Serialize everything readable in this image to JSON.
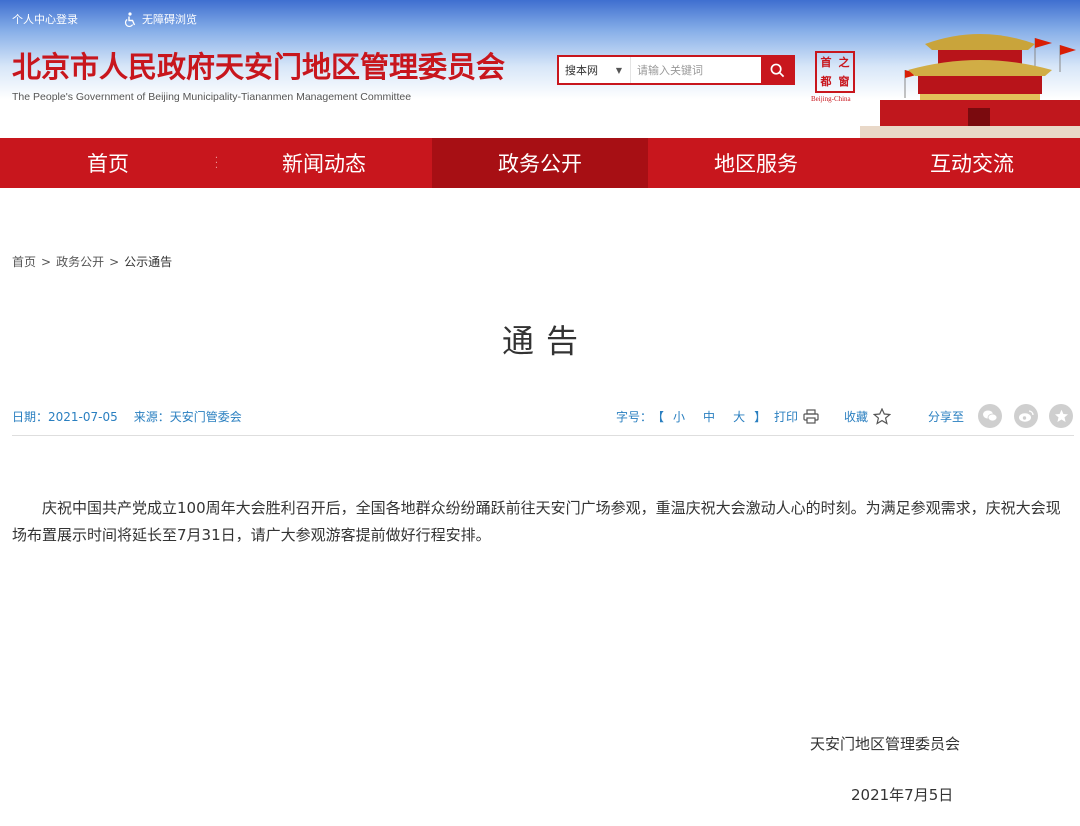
{
  "topbar": {
    "login": "个人中心登录",
    "accessibility": "无障碍浏览"
  },
  "site": {
    "title": "北京市人民政府天安门地区管理委员会",
    "subtitle": "The People's Government of Beijing Municipality-Tiananmen Management Committee"
  },
  "search": {
    "scope": "搜本网",
    "placeholder": "请输入关键词"
  },
  "seal": {
    "chars": [
      "首",
      "之",
      "都",
      "窗"
    ],
    "caption": "Beijing-China"
  },
  "nav": {
    "items": [
      {
        "label": "首页"
      },
      {
        "label": "新闻动态"
      },
      {
        "label": "政务公开"
      },
      {
        "label": "地区服务"
      },
      {
        "label": "互动交流"
      }
    ],
    "active_index": 2
  },
  "breadcrumb": {
    "items": [
      "首页",
      "政务公开",
      "公示通告"
    ],
    "separator": ">"
  },
  "article": {
    "title": "通告",
    "date_label": "日期：2021-07-05",
    "source_label": "来源：天安门管委会",
    "fontsize_label": "字号：",
    "bracket_open": "【",
    "bracket_close": "】",
    "fontsize_options": [
      "小",
      "中",
      "大"
    ],
    "print_label": "打印",
    "favorite_label": "收藏",
    "share_label": "分享至",
    "share_icons": [
      "wechat-icon",
      "weibo-icon",
      "star-icon"
    ],
    "body": "庆祝中国共产党成立100周年大会胜利召开后，全国各地群众纷纷踊跃前往天安门广场参观，重温庆祝大会激动人心的时刻。为满足参观需求，庆祝大会现场布置展示时间将延长至7月31日，请广大参观游客提前做好行程安排。",
    "signature_org": "天安门地区管理委员会",
    "signature_date": "2021年7月5日"
  },
  "colors": {
    "brand_red": "#c8161d",
    "nav_active": "#a70f14",
    "meta_blue": "#2a7fc0"
  }
}
